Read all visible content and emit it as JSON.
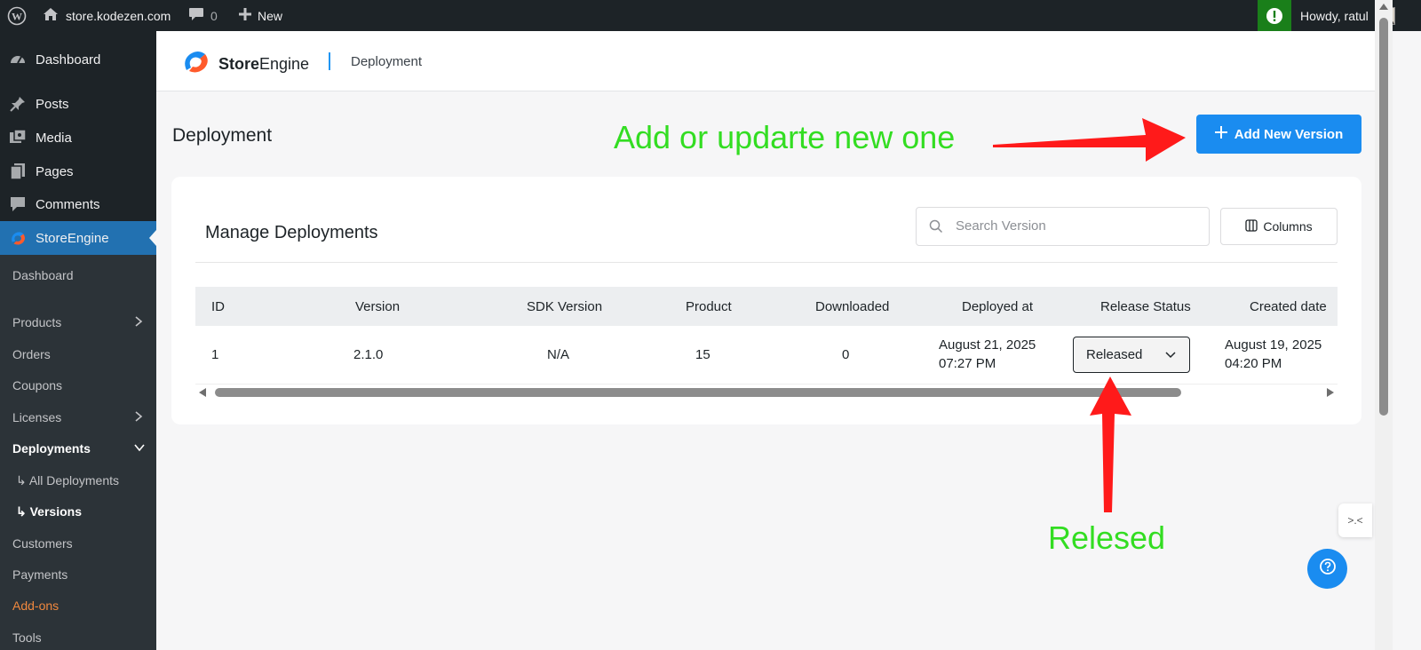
{
  "admin_bar": {
    "site": "store.kodezen.com",
    "comments_count": "0",
    "new_label": "New",
    "howdy": "Howdy, ratul"
  },
  "sidebar": {
    "items": [
      {
        "label": "Dashboard",
        "icon": "dashboard-icon"
      },
      {
        "label": "Posts",
        "icon": "pin-icon"
      },
      {
        "label": "Media",
        "icon": "media-icon"
      },
      {
        "label": "Pages",
        "icon": "pages-icon"
      },
      {
        "label": "Comments",
        "icon": "comment-icon"
      },
      {
        "label": "StoreEngine",
        "icon": "storeengine-icon",
        "active": true
      }
    ],
    "submenu": [
      {
        "label": "Dashboard"
      },
      {
        "label": "Products",
        "has_children": true
      },
      {
        "label": "Orders"
      },
      {
        "label": "Coupons"
      },
      {
        "label": "Licenses",
        "has_children": true
      },
      {
        "label": "Deployments",
        "expanded": true
      },
      {
        "label": "↳ All Deployments"
      },
      {
        "label": "↳ Versions",
        "current": true
      },
      {
        "label": "Customers"
      },
      {
        "label": "Payments"
      },
      {
        "label": "Add-ons",
        "color": "#f0883e"
      },
      {
        "label": "Tools"
      }
    ]
  },
  "header": {
    "brand_bold": "Store",
    "brand_rest": "Engine",
    "breadcrumb": "Deployment"
  },
  "page": {
    "title": "Deployment",
    "add_button": "Add New Version"
  },
  "card": {
    "title": "Manage Deployments",
    "search_placeholder": "Search Version",
    "columns_button": "Columns",
    "table": {
      "headers": [
        "ID",
        "Version",
        "SDK Version",
        "Product",
        "Downloaded",
        "Deployed at",
        "Release Status",
        "Created date"
      ],
      "rows": [
        {
          "id": "1",
          "version": "2.1.0",
          "sdk_version": "N/A",
          "product": "15",
          "downloaded": "0",
          "deployed_date": "August 21, 2025",
          "deployed_time": "07:27 PM",
          "release_status": "Released",
          "created_date": "August 19, 2025",
          "created_time": "04:20 PM"
        }
      ]
    }
  },
  "annotations": {
    "top": "Add or updarte new one",
    "bottom": "Relesed",
    "color": "#33dd22",
    "arrow_color": "#ff1a1a"
  },
  "colors": {
    "wp_dark": "#1d2327",
    "wp_blue": "#2271b1",
    "accent": "#1a8cf0"
  }
}
